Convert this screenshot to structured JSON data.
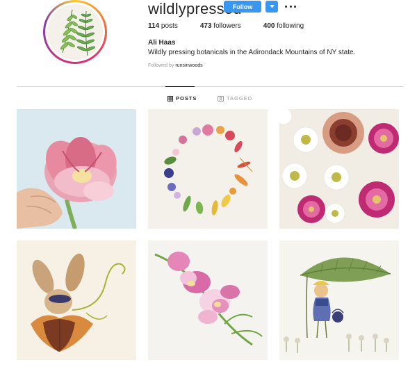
{
  "profile": {
    "username": "wildlypressed",
    "follow_label": "Follow",
    "more_icon": "more-options-icon",
    "avatar_icon": "fern-avatar",
    "full_name": "Ali Haas",
    "bio": "Wildly pressing botanicals in the Adirondack Mountains of NY state.",
    "followed_by_prefix": "Followed by",
    "followed_by_name": "runsinwoods"
  },
  "stats": {
    "posts_count": "114",
    "posts_label": "posts",
    "followers_count": "473",
    "followers_label": "followers",
    "following_count": "400",
    "following_label": "following"
  },
  "tabs": {
    "posts_label": "POSTS",
    "tagged_label": "TAGGED"
  },
  "colors": {
    "follow_blue": "#3897f0",
    "text": "#262626",
    "muted": "#999999",
    "divider": "#dbdbdb"
  },
  "posts": [
    {
      "subject": "pink tulip held in hand"
    },
    {
      "subject": "wreath of pressed flowers"
    },
    {
      "subject": "pressed daisies and asters"
    },
    {
      "subject": "botanical bunny figure"
    },
    {
      "subject": "pink freesia stem"
    },
    {
      "subject": "botanical girl under leaf umbrella"
    }
  ]
}
